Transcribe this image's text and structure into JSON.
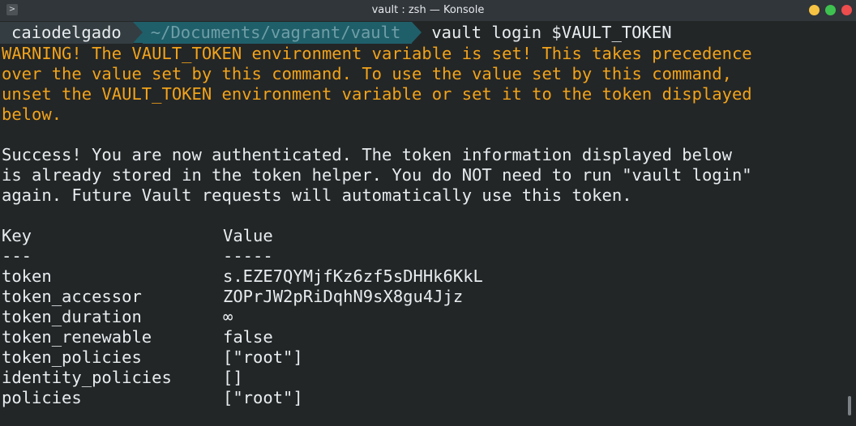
{
  "window": {
    "title": "vault : zsh — Konsole",
    "app_icon_glyph": ">",
    "buttons": {
      "minimize_color": "#f6c343",
      "maximize_color": "#3ec24f",
      "close_color": "#ed4d4d"
    }
  },
  "prompt": {
    "user": "caiodelgado",
    "path": "~/Documents/vagrant/vault",
    "command": "vault login $VAULT_TOKEN"
  },
  "warning_lines": [
    "WARNING! The VAULT_TOKEN environment variable is set! This takes precedence",
    "over the value set by this command. To use the value set by this command,",
    "unset the VAULT_TOKEN environment variable or set it to the token displayed",
    "below."
  ],
  "success_lines": [
    "Success! You are now authenticated. The token information displayed below",
    "is already stored in the token helper. You do NOT need to run \"vault login\"",
    "again. Future Vault requests will automatically use this token."
  ],
  "table": {
    "header_key": "Key",
    "header_value": "Value",
    "sep_key": "---",
    "sep_value": "-----",
    "rows": [
      {
        "key": "token",
        "value": "s.EZE7QYMjfKz6zf5sDHHk6KkL"
      },
      {
        "key": "token_accessor",
        "value": "ZOPrJW2pRiDqhN9sX8gu4Jjz"
      },
      {
        "key": "token_duration",
        "value": "∞"
      },
      {
        "key": "token_renewable",
        "value": "false"
      },
      {
        "key": "token_policies",
        "value": "[\"root\"]"
      },
      {
        "key": "identity_policies",
        "value": "[]"
      },
      {
        "key": "policies",
        "value": "[\"root\"]"
      }
    ]
  },
  "colors": {
    "background": "#232627",
    "warning": "#f2a31a",
    "text": "#e8ecef"
  }
}
